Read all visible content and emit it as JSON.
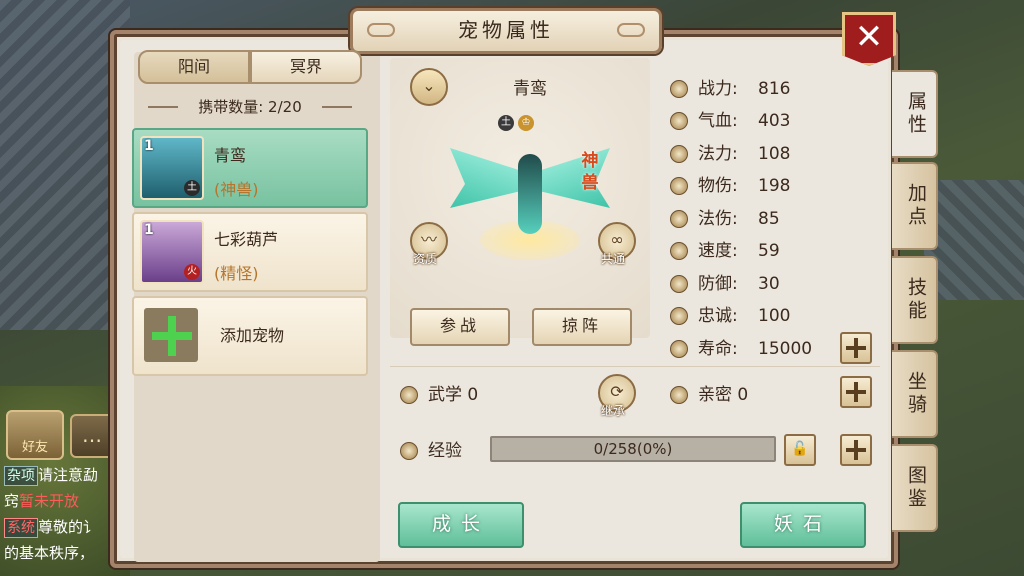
{
  "window": {
    "title": "宠物属性",
    "close_symbol": "✕"
  },
  "world_tabs": [
    "阳间",
    "冥界"
  ],
  "carry_count": "携带数量: 2/20",
  "pets": [
    {
      "level": "1",
      "element": "土",
      "name": "青鸾",
      "type": "(神兽)"
    },
    {
      "level": "1",
      "element": "火",
      "name": "七彩葫芦",
      "type": "(精怪)"
    }
  ],
  "add_pet_label": "添加宠物",
  "selected_pet": {
    "name": "青鸾",
    "badge_elem": "土",
    "badge_crown": "♔",
    "rank_text": "神兽",
    "quality_label": "资质",
    "shared_label": "共通",
    "dropdown_symbol": "⌄"
  },
  "actions": {
    "fight": "参战",
    "formation": "掠阵",
    "grow": "成长",
    "stone": "妖石",
    "inherit": "继承"
  },
  "stats": [
    {
      "label": "战力:",
      "value": "816"
    },
    {
      "label": "气血:",
      "value": "403"
    },
    {
      "label": "法力:",
      "value": "108"
    },
    {
      "label": "物伤:",
      "value": "198"
    },
    {
      "label": "法伤:",
      "value": "85"
    },
    {
      "label": "速度:",
      "value": "59"
    },
    {
      "label": "防御:",
      "value": "30"
    },
    {
      "label": "忠诚:",
      "value": "100"
    },
    {
      "label": "寿命:",
      "value": "15000"
    }
  ],
  "martial": "武学 0",
  "intimacy": "亲密 0",
  "exp": {
    "label": "经验",
    "text": "0/258(0%)",
    "fraction": 0
  },
  "side_tabs": [
    "属性",
    "加点",
    "技能",
    "坐骑",
    "图鉴"
  ],
  "hud": {
    "friend_label": "好友",
    "chat_lines": [
      {
        "tag": "杂项",
        "text": "请注意勐"
      },
      {
        "tag": "",
        "text": "窍",
        "red": "暂未开放"
      },
      {
        "tag": "系统",
        "text": "尊敬的讠"
      },
      {
        "tag": "",
        "text": "的基本秩序，"
      }
    ]
  }
}
